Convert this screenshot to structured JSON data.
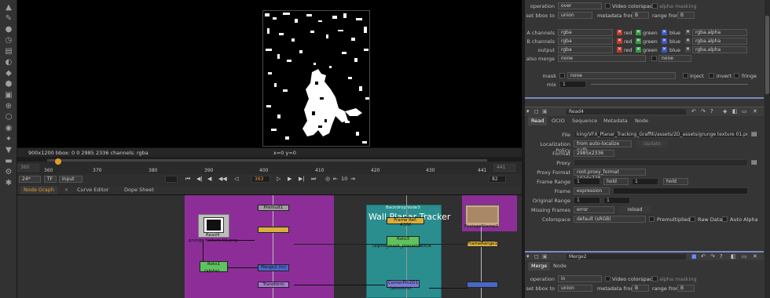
{
  "viewer": {
    "info_left": "900x1200  bbox: 0 0 2985 2336 channels: rgba",
    "coords": "x=0 y=0"
  },
  "timeline": {
    "start_frame": "360",
    "ticks": [
      "360",
      "370",
      "380",
      "390",
      "400",
      "410",
      "420",
      "430",
      "441"
    ],
    "end_frame": "441",
    "fps": "24*",
    "tf_label": "TF",
    "input_label": "Input",
    "current_frame": "363",
    "step": "10",
    "end_field": "82"
  },
  "tabs": {
    "node_graph": "Node Graph",
    "curve_editor": "Curve Editor",
    "dope_sheet": "Dope Sheet"
  },
  "nodes": {
    "read4_name": "Read4",
    "read4_sub": "grunge texture 01.png",
    "roto1": "Roto1",
    "roto1_sub": "(alpha)",
    "merge2": "Merge2 (in)",
    "premult": "Premult1",
    "transform": "Transform",
    "backdrop_name": "BackdropNode3",
    "backdrop_title": "Wall Planar Tracker",
    "frame_ref": "Frame Ref: #360",
    "roto3": "Roto3",
    "roto3_sub": "(alpha_mask_planartrack)a",
    "cornerpin": "CornerPin2D1",
    "cornerpin_sub": "(absolute)",
    "postage": "PostageStamp2",
    "framerange": "FrameRange1"
  },
  "top_merge": {
    "operation_label": "operation",
    "operation_value": "over",
    "video_colorspace": "Video colorspace",
    "alpha_masking": "alpha masking",
    "set_bbox_label": "set bbox to",
    "set_bbox_value": "union",
    "metadata_from_label": "metadata from",
    "metadata_from_value": "B",
    "range_from_label": "range from",
    "range_from_value": "B",
    "a_channels_label": "A channels",
    "b_channels_label": "B channels",
    "output_label": "output",
    "channels_value": "rgba",
    "red": "red",
    "green": "green",
    "blue": "blue",
    "rgba_alpha": "rgba.alpha",
    "also_merge_label": "also merge",
    "also_merge_value": "none",
    "also_merge_value2": "none",
    "mask_label": "mask",
    "mask_value": "none",
    "inject": "inject",
    "invert": "invert",
    "fringe": "fringe",
    "mix_label": "mix",
    "mix_value": "1"
  },
  "read4": {
    "title": "Read4",
    "tabs": [
      "Read",
      "OCIO",
      "Sequence",
      "Metadata",
      "Node"
    ],
    "file_label": "File",
    "file_value": "king/VFX_Planar_Tracking_Graffiti/assets/2D_assets/grunge texture 01.png",
    "localization_label": "Localization Policy",
    "localization_value": "from auto-localize path",
    "update_btn": "Update",
    "format_label": "Format",
    "format_value": "2985x2336",
    "proxy_label": "Proxy",
    "proxy_format_label": "Proxy Format",
    "proxy_format_value": "root.proxy_format 1024x778",
    "frame_range_label": "Frame Range",
    "frame_range_start": "1",
    "frame_range_before": "hold",
    "frame_range_end": "1",
    "frame_range_after": "hold",
    "frame_label": "Frame",
    "frame_value": "expression",
    "original_range_label": "Original Range",
    "original_start": "1",
    "original_end": "1",
    "missing_frames_label": "Missing Frames",
    "missing_frames_value": "error",
    "reload_btn": "reload",
    "colorspace_label": "Colorspace",
    "colorspace_value": "default (sRGB)",
    "premultiplied": "Premultiplied",
    "raw_data": "Raw Data",
    "auto_alpha": "Auto Alpha"
  },
  "merge2": {
    "title": "Merge2",
    "tabs": [
      "Merge",
      "Node"
    ],
    "operation_label": "operation",
    "operation_value": "in",
    "video_colorspace": "Video colorspace",
    "alpha_masking": "alpha masking",
    "set_bbox_label": "set bbox to",
    "set_bbox_value": "union",
    "metadata_from_label": "metadata from",
    "metadata_from_value": "B",
    "range_from_label": "range from",
    "range_from_value": "B"
  }
}
